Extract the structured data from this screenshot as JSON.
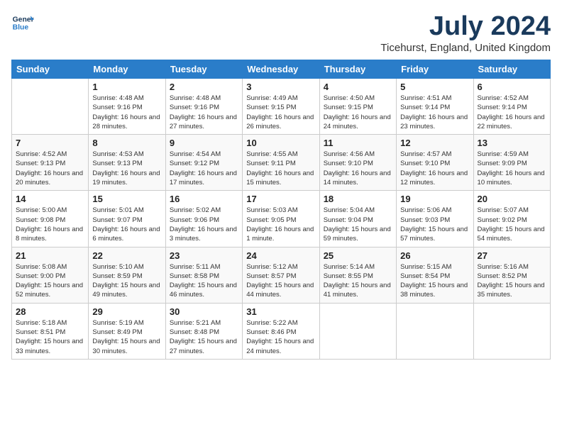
{
  "logo": {
    "line1": "General",
    "line2": "Blue"
  },
  "title": "July 2024",
  "location": "Ticehurst, England, United Kingdom",
  "weekdays": [
    "Sunday",
    "Monday",
    "Tuesday",
    "Wednesday",
    "Thursday",
    "Friday",
    "Saturday"
  ],
  "weeks": [
    [
      {
        "day": "",
        "sunrise": "",
        "sunset": "",
        "daylight": ""
      },
      {
        "day": "1",
        "sunrise": "Sunrise: 4:48 AM",
        "sunset": "Sunset: 9:16 PM",
        "daylight": "Daylight: 16 hours and 28 minutes."
      },
      {
        "day": "2",
        "sunrise": "Sunrise: 4:48 AM",
        "sunset": "Sunset: 9:16 PM",
        "daylight": "Daylight: 16 hours and 27 minutes."
      },
      {
        "day": "3",
        "sunrise": "Sunrise: 4:49 AM",
        "sunset": "Sunset: 9:15 PM",
        "daylight": "Daylight: 16 hours and 26 minutes."
      },
      {
        "day": "4",
        "sunrise": "Sunrise: 4:50 AM",
        "sunset": "Sunset: 9:15 PM",
        "daylight": "Daylight: 16 hours and 24 minutes."
      },
      {
        "day": "5",
        "sunrise": "Sunrise: 4:51 AM",
        "sunset": "Sunset: 9:14 PM",
        "daylight": "Daylight: 16 hours and 23 minutes."
      },
      {
        "day": "6",
        "sunrise": "Sunrise: 4:52 AM",
        "sunset": "Sunset: 9:14 PM",
        "daylight": "Daylight: 16 hours and 22 minutes."
      }
    ],
    [
      {
        "day": "7",
        "sunrise": "Sunrise: 4:52 AM",
        "sunset": "Sunset: 9:13 PM",
        "daylight": "Daylight: 16 hours and 20 minutes."
      },
      {
        "day": "8",
        "sunrise": "Sunrise: 4:53 AM",
        "sunset": "Sunset: 9:13 PM",
        "daylight": "Daylight: 16 hours and 19 minutes."
      },
      {
        "day": "9",
        "sunrise": "Sunrise: 4:54 AM",
        "sunset": "Sunset: 9:12 PM",
        "daylight": "Daylight: 16 hours and 17 minutes."
      },
      {
        "day": "10",
        "sunrise": "Sunrise: 4:55 AM",
        "sunset": "Sunset: 9:11 PM",
        "daylight": "Daylight: 16 hours and 15 minutes."
      },
      {
        "day": "11",
        "sunrise": "Sunrise: 4:56 AM",
        "sunset": "Sunset: 9:10 PM",
        "daylight": "Daylight: 16 hours and 14 minutes."
      },
      {
        "day": "12",
        "sunrise": "Sunrise: 4:57 AM",
        "sunset": "Sunset: 9:10 PM",
        "daylight": "Daylight: 16 hours and 12 minutes."
      },
      {
        "day": "13",
        "sunrise": "Sunrise: 4:59 AM",
        "sunset": "Sunset: 9:09 PM",
        "daylight": "Daylight: 16 hours and 10 minutes."
      }
    ],
    [
      {
        "day": "14",
        "sunrise": "Sunrise: 5:00 AM",
        "sunset": "Sunset: 9:08 PM",
        "daylight": "Daylight: 16 hours and 8 minutes."
      },
      {
        "day": "15",
        "sunrise": "Sunrise: 5:01 AM",
        "sunset": "Sunset: 9:07 PM",
        "daylight": "Daylight: 16 hours and 6 minutes."
      },
      {
        "day": "16",
        "sunrise": "Sunrise: 5:02 AM",
        "sunset": "Sunset: 9:06 PM",
        "daylight": "Daylight: 16 hours and 3 minutes."
      },
      {
        "day": "17",
        "sunrise": "Sunrise: 5:03 AM",
        "sunset": "Sunset: 9:05 PM",
        "daylight": "Daylight: 16 hours and 1 minute."
      },
      {
        "day": "18",
        "sunrise": "Sunrise: 5:04 AM",
        "sunset": "Sunset: 9:04 PM",
        "daylight": "Daylight: 15 hours and 59 minutes."
      },
      {
        "day": "19",
        "sunrise": "Sunrise: 5:06 AM",
        "sunset": "Sunset: 9:03 PM",
        "daylight": "Daylight: 15 hours and 57 minutes."
      },
      {
        "day": "20",
        "sunrise": "Sunrise: 5:07 AM",
        "sunset": "Sunset: 9:02 PM",
        "daylight": "Daylight: 15 hours and 54 minutes."
      }
    ],
    [
      {
        "day": "21",
        "sunrise": "Sunrise: 5:08 AM",
        "sunset": "Sunset: 9:00 PM",
        "daylight": "Daylight: 15 hours and 52 minutes."
      },
      {
        "day": "22",
        "sunrise": "Sunrise: 5:10 AM",
        "sunset": "Sunset: 8:59 PM",
        "daylight": "Daylight: 15 hours and 49 minutes."
      },
      {
        "day": "23",
        "sunrise": "Sunrise: 5:11 AM",
        "sunset": "Sunset: 8:58 PM",
        "daylight": "Daylight: 15 hours and 46 minutes."
      },
      {
        "day": "24",
        "sunrise": "Sunrise: 5:12 AM",
        "sunset": "Sunset: 8:57 PM",
        "daylight": "Daylight: 15 hours and 44 minutes."
      },
      {
        "day": "25",
        "sunrise": "Sunrise: 5:14 AM",
        "sunset": "Sunset: 8:55 PM",
        "daylight": "Daylight: 15 hours and 41 minutes."
      },
      {
        "day": "26",
        "sunrise": "Sunrise: 5:15 AM",
        "sunset": "Sunset: 8:54 PM",
        "daylight": "Daylight: 15 hours and 38 minutes."
      },
      {
        "day": "27",
        "sunrise": "Sunrise: 5:16 AM",
        "sunset": "Sunset: 8:52 PM",
        "daylight": "Daylight: 15 hours and 35 minutes."
      }
    ],
    [
      {
        "day": "28",
        "sunrise": "Sunrise: 5:18 AM",
        "sunset": "Sunset: 8:51 PM",
        "daylight": "Daylight: 15 hours and 33 minutes."
      },
      {
        "day": "29",
        "sunrise": "Sunrise: 5:19 AM",
        "sunset": "Sunset: 8:49 PM",
        "daylight": "Daylight: 15 hours and 30 minutes."
      },
      {
        "day": "30",
        "sunrise": "Sunrise: 5:21 AM",
        "sunset": "Sunset: 8:48 PM",
        "daylight": "Daylight: 15 hours and 27 minutes."
      },
      {
        "day": "31",
        "sunrise": "Sunrise: 5:22 AM",
        "sunset": "Sunset: 8:46 PM",
        "daylight": "Daylight: 15 hours and 24 minutes."
      },
      {
        "day": "",
        "sunrise": "",
        "sunset": "",
        "daylight": ""
      },
      {
        "day": "",
        "sunrise": "",
        "sunset": "",
        "daylight": ""
      },
      {
        "day": "",
        "sunrise": "",
        "sunset": "",
        "daylight": ""
      }
    ]
  ]
}
